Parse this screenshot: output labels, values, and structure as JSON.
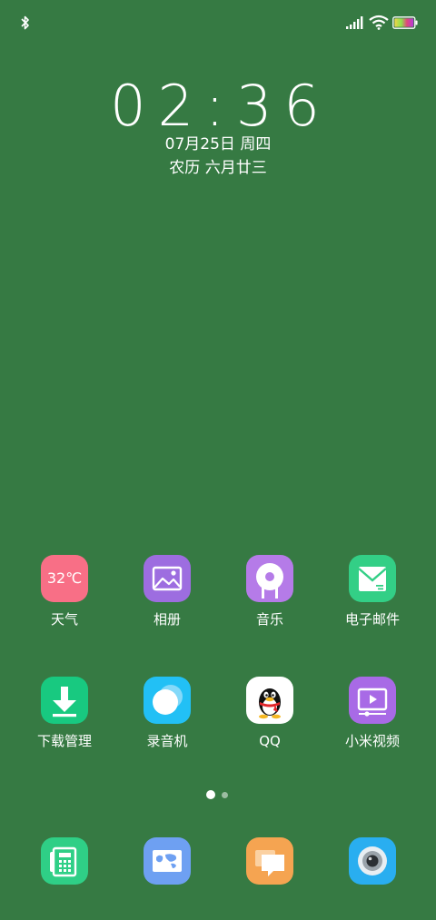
{
  "clock": {
    "time": "02:36",
    "date": "07月25日 周四",
    "lunar": "农历 六月廿三"
  },
  "weather_temp": "32℃",
  "apps": [
    {
      "label": "天气",
      "icon": "weather-icon",
      "color": "#f86f86"
    },
    {
      "label": "相册",
      "icon": "gallery-icon",
      "color": "#9d6de0"
    },
    {
      "label": "音乐",
      "icon": "music-icon",
      "color": "#b57be8"
    },
    {
      "label": "电子邮件",
      "icon": "email-icon",
      "color": "#33cf86"
    },
    {
      "label": "下载管理",
      "icon": "download-icon",
      "color": "#18c980"
    },
    {
      "label": "录音机",
      "icon": "recorder-icon",
      "color": "#22c0f5"
    },
    {
      "label": "QQ",
      "icon": "qq-penguin-icon",
      "color": "#ffffff"
    },
    {
      "label": "小米视频",
      "icon": "video-icon",
      "color": "#a86ae6"
    }
  ],
  "dock": [
    {
      "icon": "phone-icon",
      "color": "#2fcf86"
    },
    {
      "icon": "browser-map-icon",
      "color": "#6ea0f2"
    },
    {
      "icon": "messages-icon",
      "color": "#f5a451"
    },
    {
      "icon": "camera-icon",
      "color": "#29aef0"
    }
  ],
  "pages": {
    "count": 2,
    "active": 1
  }
}
